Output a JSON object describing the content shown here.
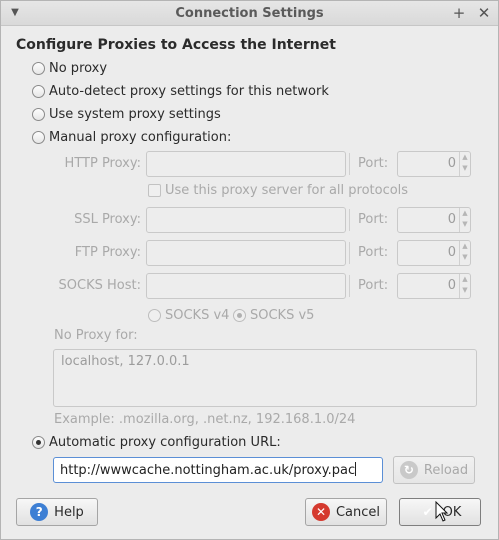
{
  "window": {
    "title": "Connection Settings"
  },
  "heading": "Configure Proxies to Access the Internet",
  "options": {
    "no_proxy": "No proxy",
    "auto_detect": "Auto-detect proxy settings for this network",
    "system": "Use system proxy settings",
    "manual": "Manual proxy configuration:",
    "automatic_url": "Automatic proxy configuration URL:"
  },
  "selected_option": "automatic_url",
  "manual": {
    "http_label": "HTTP Proxy:",
    "ssl_label": "SSL Proxy:",
    "ftp_label": "FTP Proxy:",
    "socks_label": "SOCKS Host:",
    "port_label": "Port:",
    "http_port": "0",
    "ssl_port": "0",
    "ftp_port": "0",
    "socks_port": "0",
    "same_proxy_label": "Use this proxy server for all protocols",
    "socks_v4": "SOCKS v4",
    "socks_v5": "SOCKS v5"
  },
  "no_proxy": {
    "label": "No Proxy for:",
    "value": "localhost, 127.0.0.1",
    "example": "Example: .mozilla.org, .net.nz, 192.168.1.0/24"
  },
  "pac_url": "http://wwwcache.nottingham.ac.uk/proxy.pac",
  "buttons": {
    "reload": "Reload",
    "help": "Help",
    "cancel": "Cancel",
    "ok": "OK"
  }
}
